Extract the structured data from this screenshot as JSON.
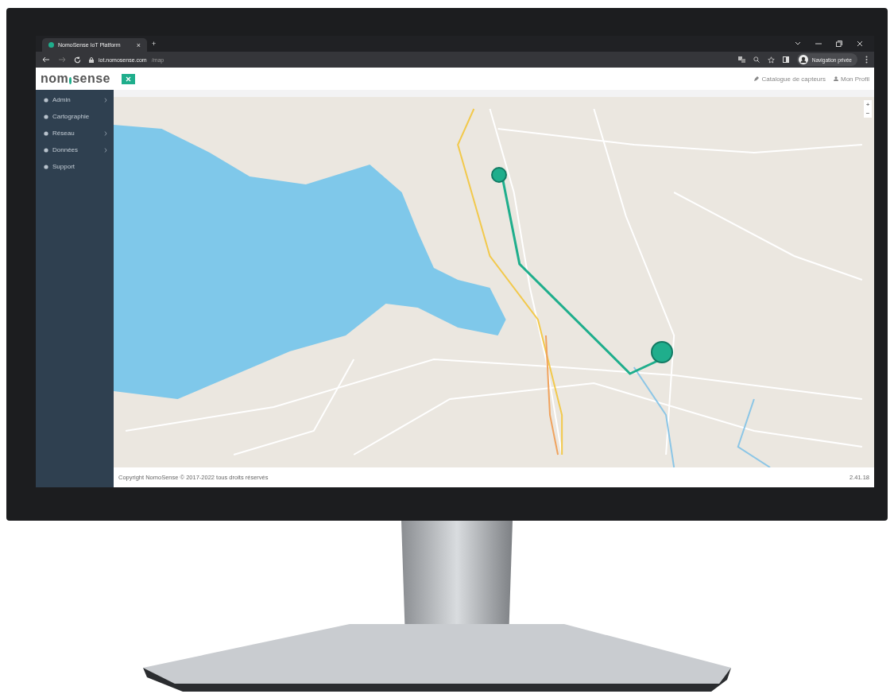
{
  "browser": {
    "tab": {
      "title": "NomoSense IoT Platform",
      "close": "×",
      "selected": true
    },
    "new_tab": "+",
    "address": {
      "host": "iot.nomosense.com",
      "path": "/map"
    },
    "profile": "Navigation privée"
  },
  "app": {
    "logo": {
      "left": "nom",
      "right": "sense"
    },
    "header_links": [
      "Catalogue de capteurs",
      "Mon Profil"
    ],
    "sidebar": [
      {
        "label": "Admin",
        "expandable": true
      },
      {
        "label": "Cartographie",
        "expandable": false
      },
      {
        "label": "Réseau",
        "expandable": true
      },
      {
        "label": "Données",
        "expandable": true
      },
      {
        "label": "Support",
        "expandable": false
      }
    ],
    "map": {
      "zoom_in": "+",
      "zoom_out": "−"
    },
    "footer": {
      "copyright": "Copyright NomoSense © 2017-2022 tous droits réservés",
      "version": "2.41.18"
    }
  }
}
